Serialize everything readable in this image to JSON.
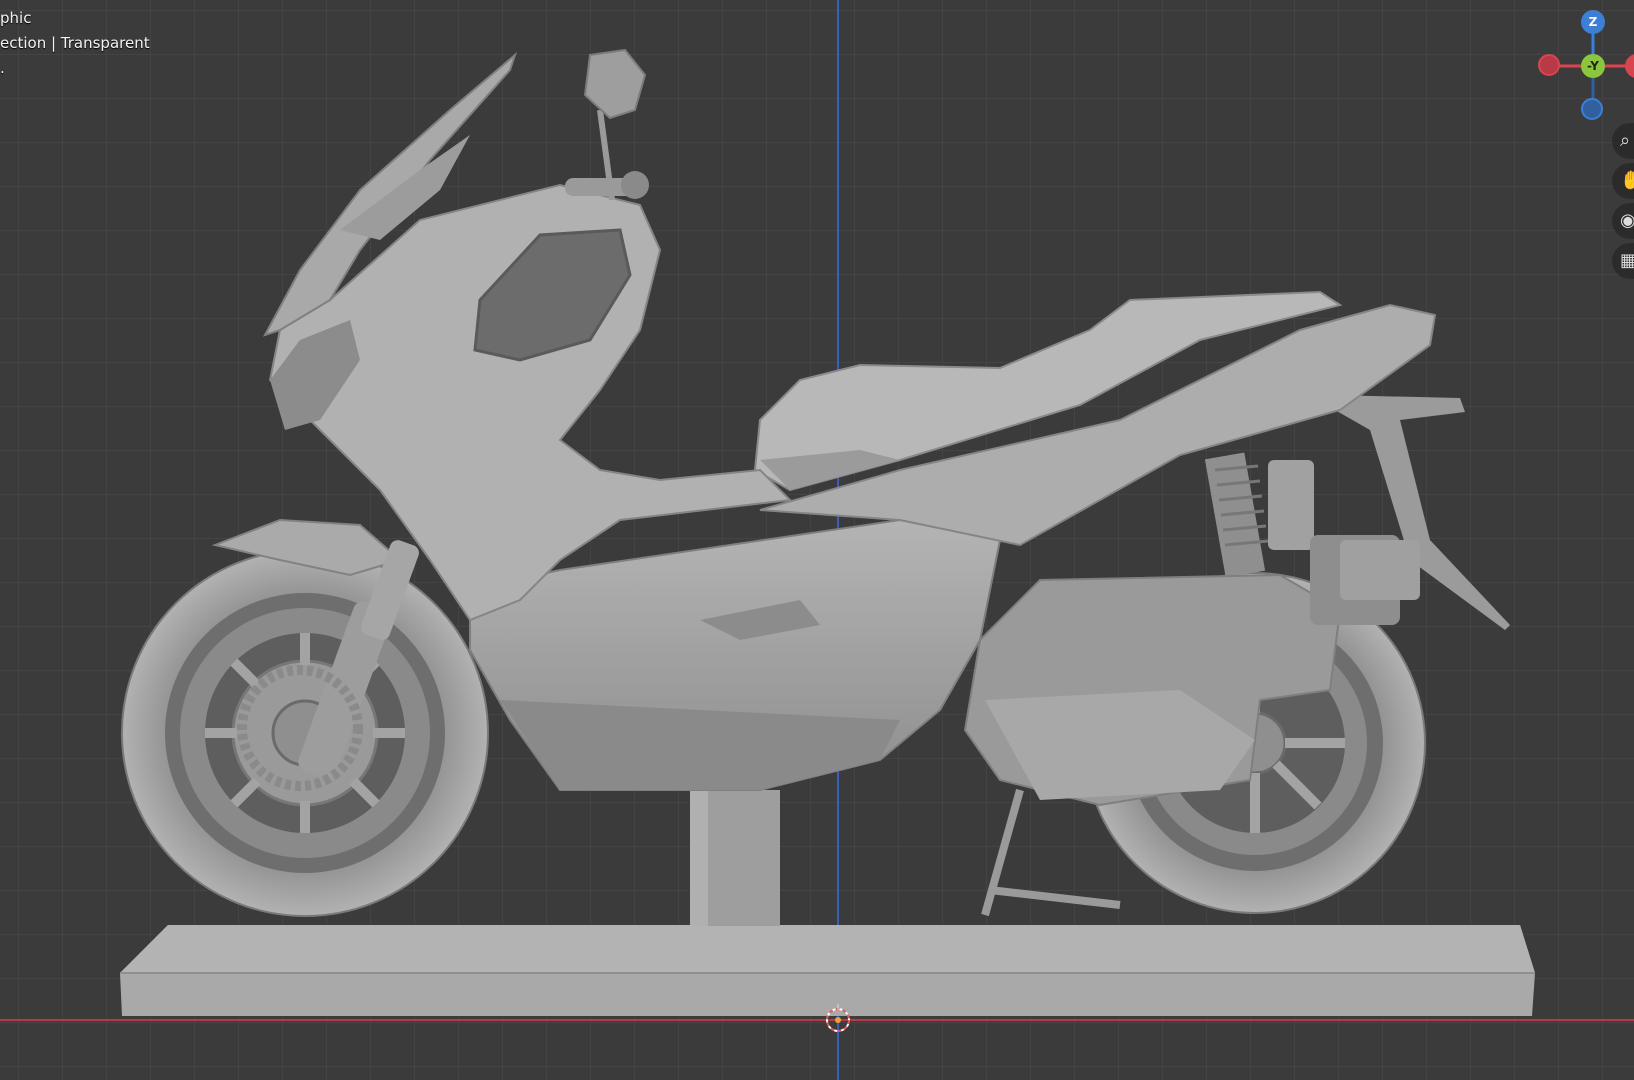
{
  "viewport": {
    "overlay_lines": [
      "phic",
      "ection | Transparent",
      "."
    ],
    "background_color": "#3b3b3b",
    "grid_color": "#444444",
    "x_axis_color": "#b83a46",
    "y_axis_color": "#3c5fb0",
    "model_color": "#a5a5a5"
  },
  "gizmo": {
    "z_label": "Z",
    "neg_y_label": "-Y",
    "z_color": "#3b7fd6",
    "y_color": "#8cc63f",
    "x_color": "#d8444f",
    "neg_z_color": "#325f9e"
  },
  "nav_buttons": [
    {
      "name": "zoom-icon",
      "glyph": "⌕"
    },
    {
      "name": "pan-hand-icon",
      "glyph": "✋"
    },
    {
      "name": "camera-icon",
      "glyph": "◉"
    },
    {
      "name": "grid-icon",
      "glyph": "▦"
    }
  ]
}
